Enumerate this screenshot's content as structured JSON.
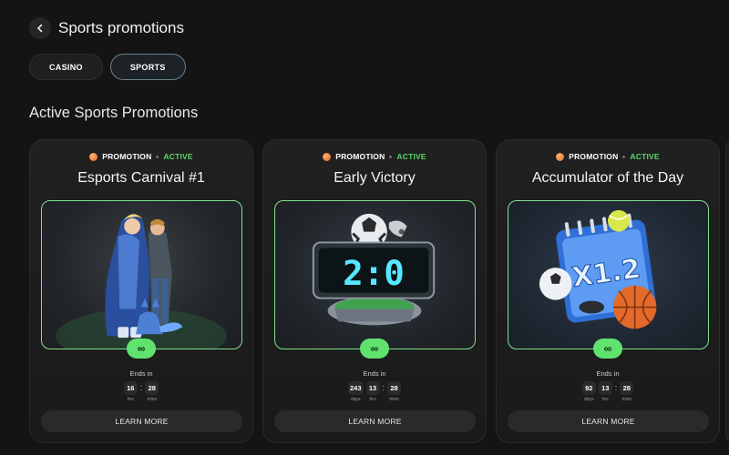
{
  "header": {
    "title": "Sports promotions",
    "back_icon": "chevron-left-icon"
  },
  "tabs": [
    {
      "label": "CASINO",
      "active": false
    },
    {
      "label": "SPORTS",
      "active": true
    }
  ],
  "section": {
    "title": "Active Sports Promotions"
  },
  "cards": [
    {
      "category": "PROMOTION",
      "status": "ACTIVE",
      "title": "Esports Carnival #1",
      "image": "esports-heroes-illustration",
      "badge": "∞",
      "ends_label": "Ends in",
      "timer": [
        {
          "value": "16",
          "unit": "hrs"
        },
        {
          "value": "28",
          "unit": "mins"
        }
      ],
      "button": "LEARN MORE"
    },
    {
      "category": "PROMOTION",
      "status": "ACTIVE",
      "title": "Early Victory",
      "image": "scoreboard-illustration",
      "scoreboard": "2:0",
      "badge": "∞",
      "ends_label": "Ends in",
      "timer": [
        {
          "value": "243",
          "unit": "days"
        },
        {
          "value": "13",
          "unit": "hrs"
        },
        {
          "value": "28",
          "unit": "mins"
        }
      ],
      "button": "LEARN MORE"
    },
    {
      "category": "PROMOTION",
      "status": "ACTIVE",
      "title": "Accumulator of the Day",
      "image": "calendar-balls-illustration",
      "calendar_text": "X1.2",
      "badge": "∞",
      "ends_label": "Ends in",
      "timer": [
        {
          "value": "92",
          "unit": "days"
        },
        {
          "value": "13",
          "unit": "hrs"
        },
        {
          "value": "28",
          "unit": "mins"
        }
      ],
      "button": "LEARN MORE"
    }
  ],
  "colors": {
    "background": "#141414",
    "card": "#1e1e1e",
    "active_green": "#58d96a",
    "badge_green": "#5fe26e",
    "tab_active_border": "#6b7f8c"
  }
}
